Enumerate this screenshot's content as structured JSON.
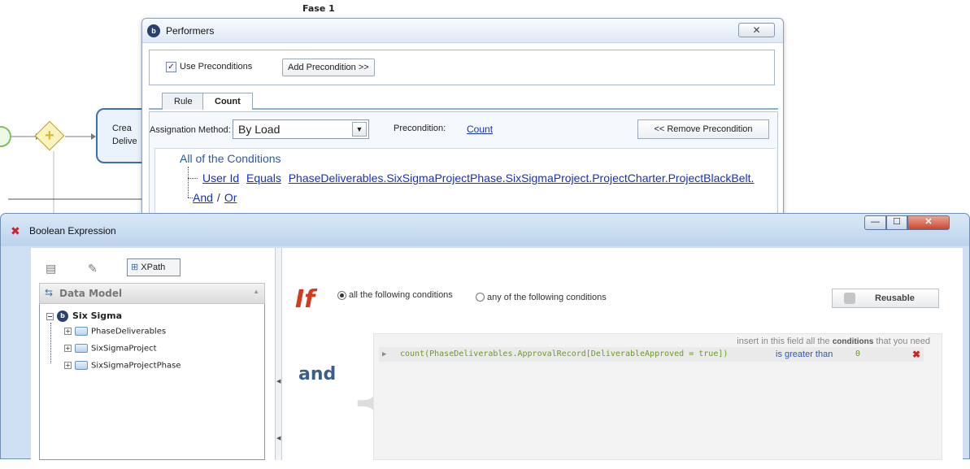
{
  "background": {
    "lane_title": "Fase 1",
    "task_label": "Crea\nDelive"
  },
  "performers": {
    "title": "Performers",
    "close_glyph": "✕",
    "use_preconditions_label": "Use Preconditions",
    "use_preconditions_checked": true,
    "add_precondition_label": "Add Precondition >>",
    "tabs": [
      {
        "label": "Rule",
        "active": false
      },
      {
        "label": "Count",
        "active": true
      }
    ],
    "assignation_label": "Assignation Method:",
    "assignation_value": "By Load",
    "precondition_label": "Precondition:",
    "precondition_link": "Count",
    "remove_precondition_label": "<< Remove Precondition",
    "conditions_header": "All of the Conditions",
    "condition_row": {
      "field": "User Id",
      "operator": "Equals",
      "value": "PhaseDeliverables.SixSigmaProjectPhase.SixSigmaProject.ProjectCharter.ProjectBlackBelt."
    },
    "and_label": "And",
    "or_separator": "/",
    "or_label": "Or"
  },
  "boolean_expression": {
    "title": "Boolean Expression",
    "window_buttons": {
      "minimize": "—",
      "maximize": "☐",
      "close": "✕"
    },
    "left_panel": {
      "xpath_label": "XPath",
      "data_model_title": "Data Model",
      "tree_root": "Six Sigma",
      "tree_children": [
        "PhaseDeliverables",
        "SixSigmaProject",
        "SixSigmaProjectPhase"
      ]
    },
    "if_word": "If",
    "radio_all_label": "all the following conditions",
    "radio_any_label": "any of the following conditions",
    "radio_selected": "all",
    "reusable_label": "Reusable",
    "and_word": "and",
    "hint_prefix": "insert in this field all the",
    "hint_keyword": "conditions",
    "hint_suffix": "that you need",
    "expression": {
      "left": "count(PhaseDeliverables.ApprovalRecord[DeliverableApproved = true])",
      "operator": "is greater than",
      "value": "0",
      "delete_glyph": "✖"
    }
  },
  "colors": {
    "if_red": "#d43a1e",
    "expression_green": "#6aa012",
    "operator_blue": "#2f57b3",
    "link_blue": "#1530c8"
  }
}
